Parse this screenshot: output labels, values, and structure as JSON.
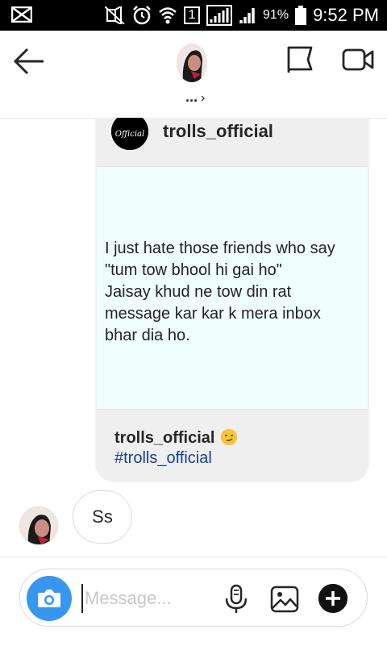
{
  "status_bar": {
    "sim_slot": "1",
    "battery_percent": "91%",
    "time": "9:52 PM"
  },
  "header": {
    "contact_name": "...",
    "chevron": "›"
  },
  "shared_post": {
    "username": "trolls_official",
    "logo_text": "Official",
    "image_text": "I just hate those friends who say\n\"tum tow bhool hi gai ho\"\nJaisay khud ne tow din rat\nmessage kar kar k mera inbox\nbhar dia ho.",
    "caption_user": "trolls_official",
    "caption_hashtag": "#trolls_official"
  },
  "messages": [
    {
      "text": "Ss"
    }
  ],
  "composer": {
    "placeholder": "Message..."
  },
  "colors": {
    "accent": "#3797f0",
    "hashtag": "#1b3f8a",
    "card_bg": "#efefef",
    "post_bg": "#f0fffd"
  }
}
